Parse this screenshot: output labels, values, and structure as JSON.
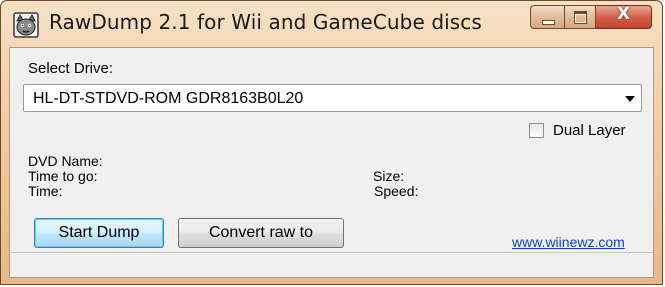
{
  "window": {
    "title": "RawDump 2.1 for Wii and GameCube discs",
    "icon": "cat-face-icon",
    "caption_buttons": {
      "minimize_icon": "minimize-icon",
      "maximize_icon": "maximize-icon",
      "close_glyph": "X"
    }
  },
  "drive": {
    "label": "Select Drive:",
    "selected": "HL-DT-STDVD-ROM GDR8163B0L20"
  },
  "options": {
    "dual_layer_label": "Dual Layer",
    "dual_layer_checked": false
  },
  "info": {
    "dvd_name_label": "DVD Name:",
    "time_to_go_label": "Time to go:",
    "time_label": "Time:",
    "size_label": "Size:",
    "speed_label": "Speed:"
  },
  "actions": {
    "start_dump_label": "Start Dump",
    "convert_raw_label": "Convert raw to"
  },
  "footer": {
    "link_text": "www.wiinewz.com"
  },
  "colors": {
    "titlebar": "#eec9a0",
    "close_button": "#d4624b",
    "link": "#0b3fd0",
    "client_background": "#f0f0f0"
  }
}
